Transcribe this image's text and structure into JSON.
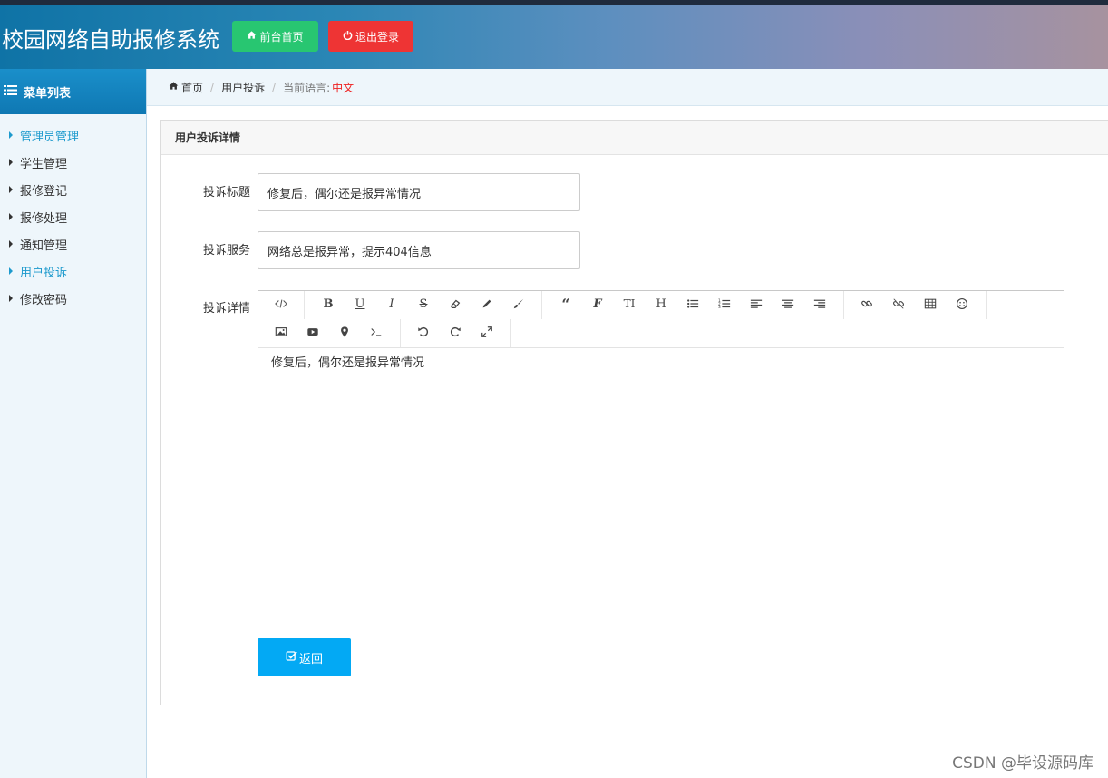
{
  "header": {
    "title": "校园网络自助报修系统",
    "home_button": "前台首页",
    "logout_button": "退出登录",
    "home_color": "#28c671",
    "logout_color": "#ee3434"
  },
  "sidebar": {
    "title": "菜单列表",
    "items": [
      {
        "label": "管理员管理"
      },
      {
        "label": "学生管理"
      },
      {
        "label": "报修登记"
      },
      {
        "label": "报修处理"
      },
      {
        "label": "通知管理"
      },
      {
        "label": "用户投诉"
      },
      {
        "label": "修改密码"
      }
    ]
  },
  "breadcrumb": {
    "home": "首页",
    "current": "用户投诉",
    "lang_label": "当前语言:",
    "lang_value": "中文"
  },
  "panel": {
    "title": "用户投诉详情",
    "fields": {
      "title_label": "投诉标题",
      "title_value": "修复后，偶尔还是报异常情况",
      "service_label": "投诉服务",
      "service_value": "网络总是报异常，提示404信息",
      "detail_label": "投诉详情"
    },
    "editor_content": "修复后，偶尔还是报异常情况",
    "back_button": "返回"
  },
  "toolbar_icons": [
    "code-view",
    "bold",
    "underline",
    "italic",
    "strikethrough",
    "eraser",
    "pencil",
    "brush",
    "quote",
    "font",
    "text-height",
    "heading",
    "unordered-list",
    "ordered-list",
    "align-left",
    "align-center",
    "align-right",
    "link",
    "unlink",
    "table",
    "emoji",
    "image",
    "video",
    "map-marker",
    "terminal",
    "undo",
    "redo",
    "fullscreen"
  ],
  "watermark": "CSDN @毕设源码库"
}
